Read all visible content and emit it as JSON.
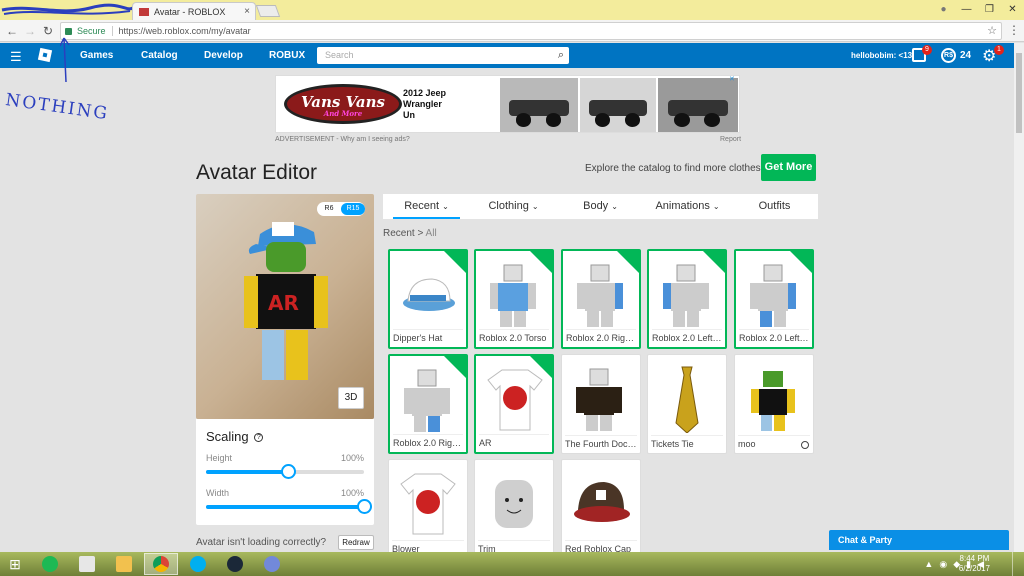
{
  "browser": {
    "tab_title": "Avatar - ROBLOX",
    "tab_close": "×",
    "secure_label": "Secure",
    "url": "https://web.roblox.com/my/avatar"
  },
  "annotation": "NOTHING",
  "nav": {
    "links": [
      "Games",
      "Catalog",
      "Develop",
      "ROBUX"
    ],
    "search_placeholder": "Search",
    "username": "hellobobim: <13",
    "messages_badge": "9",
    "robux_symbol": "R$",
    "robux": "24",
    "settings_badge": "1"
  },
  "ad": {
    "brand": "Vans Vans",
    "brand_sub": "And More",
    "lines": [
      "2012 Jeep",
      "Wrangler",
      "Un"
    ],
    "note": "ADVERTISEMENT - Why am I seeing ads?",
    "report": "Report"
  },
  "editor": {
    "title": "Avatar Editor",
    "explore_text": "Explore the catalog to find more clothes!",
    "get_more": "Get More",
    "rig_options": [
      "R6",
      "R15"
    ],
    "btn_3d": "3D",
    "scaling_title": "Scaling",
    "height_label": "Height",
    "height_value": "100%",
    "height_fraction": 0.52,
    "width_label": "Width",
    "width_value": "100%",
    "width_fraction": 1.0,
    "loading_text": "Avatar isn't loading correctly?",
    "redraw": "Redraw",
    "tabs": [
      "Recent",
      "Clothing",
      "Body",
      "Animations",
      "Outfits"
    ],
    "crumb_current": "Recent",
    "crumb_sep": ">",
    "crumb_child": "All",
    "items": [
      {
        "name": "Dipper's Hat",
        "selected": true,
        "icon": "hat"
      },
      {
        "name": "Roblox 2.0 Torso",
        "selected": true,
        "icon": "torso"
      },
      {
        "name": "Roblox 2.0 Right ...",
        "selected": true,
        "icon": "right-arm"
      },
      {
        "name": "Roblox 2.0 Left A...",
        "selected": true,
        "icon": "left-arm"
      },
      {
        "name": "Roblox 2.0 Left L...",
        "selected": true,
        "icon": "left-leg"
      },
      {
        "name": "Roblox 2.0 Right ...",
        "selected": true,
        "icon": "right-leg"
      },
      {
        "name": "AR",
        "selected": true,
        "icon": "tshirt"
      },
      {
        "name": "The Fourth Doct...",
        "selected": false,
        "icon": "shirt"
      },
      {
        "name": "Tickets Tie",
        "selected": false,
        "icon": "tie"
      },
      {
        "name": "moo",
        "selected": false,
        "icon": "outfit"
      },
      {
        "name": "Blower",
        "selected": false,
        "icon": "tshirt"
      },
      {
        "name": "Trim",
        "selected": false,
        "icon": "face"
      },
      {
        "name": "Red Roblox Cap",
        "selected": false,
        "icon": "cap"
      }
    ]
  },
  "chat_label": "Chat & Party",
  "clock": {
    "time": "8:44 PM",
    "date": "6/2/2017"
  },
  "colors": {
    "nav_blue": "#0074c2",
    "green": "#02b757",
    "accent": "#00a2ff"
  }
}
